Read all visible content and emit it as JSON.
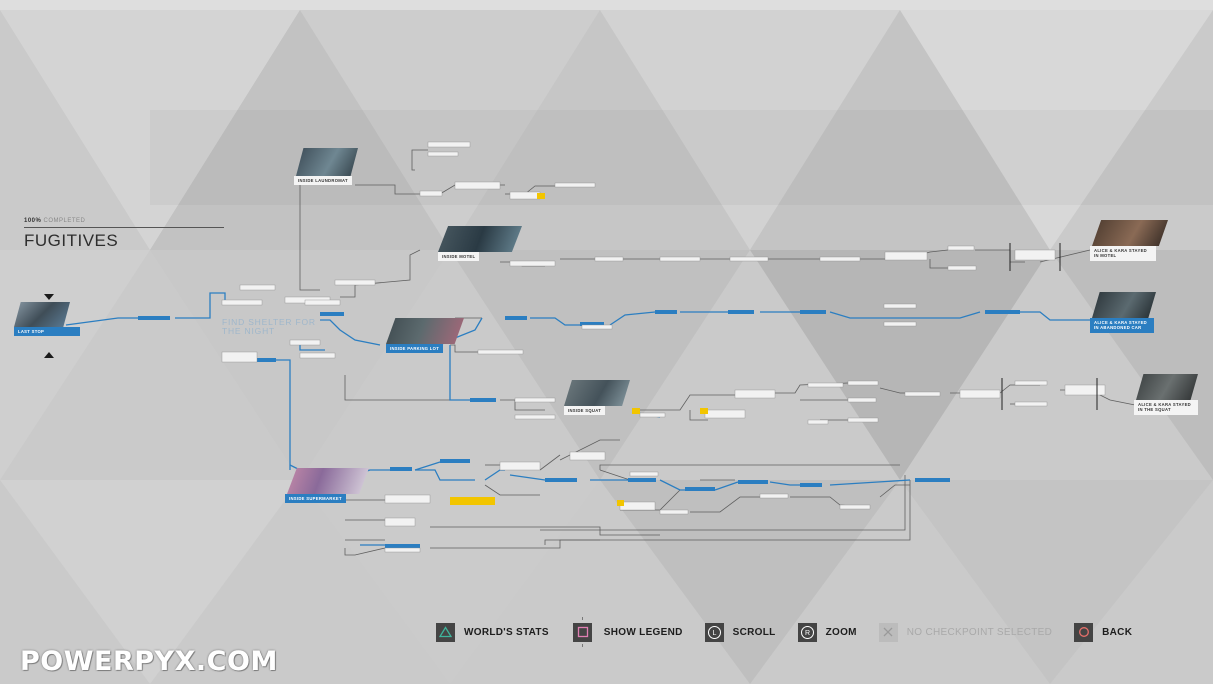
{
  "chapter": {
    "completion_pct": "100%",
    "completion_word": "COMPLETED",
    "title": "FUGITIVES"
  },
  "nodes": {
    "last_stop": "LAST STOP",
    "inside_laundromat": "INSIDE LAUNDROMAT",
    "inside_motel": "INSIDE MOTEL",
    "inside_parking_lot": "INSIDE PARKING LOT",
    "inside_squat": "INSIDE SQUAT",
    "inside_supermarket": "INSIDE SUPERMARKET",
    "find_shelter": "FIND SHELTER FOR THE NIGHT",
    "ending_motel": "ALICE & KARA STAYED IN MOTEL",
    "ending_car": "ALICE & KARA STAYED IN ABANDONED CAR",
    "ending_squat": "ALICE & KARA STAYED IN THE SQUAT"
  },
  "bottom_bar": {
    "worlds_stats": "WORLD'S STATS",
    "show_legend": "SHOW LEGEND",
    "scroll": "SCROLL",
    "zoom": "ZOOM",
    "no_checkpoint": "NO CHECKPOINT SELECTED",
    "back": "BACK",
    "scroll_glyph": "L",
    "zoom_glyph": "R"
  },
  "watermark": "POWERPYX.COM",
  "colors": {
    "accent_blue": "#2b7ec1",
    "highlight_yellow": "#f2c500",
    "background": "#c9c9c9"
  },
  "icons": [
    "triangle-icon",
    "square-icon",
    "l-stick-icon",
    "r-stick-icon",
    "cross-icon",
    "circle-icon",
    "chevron-up-icon",
    "chevron-down-icon"
  ]
}
